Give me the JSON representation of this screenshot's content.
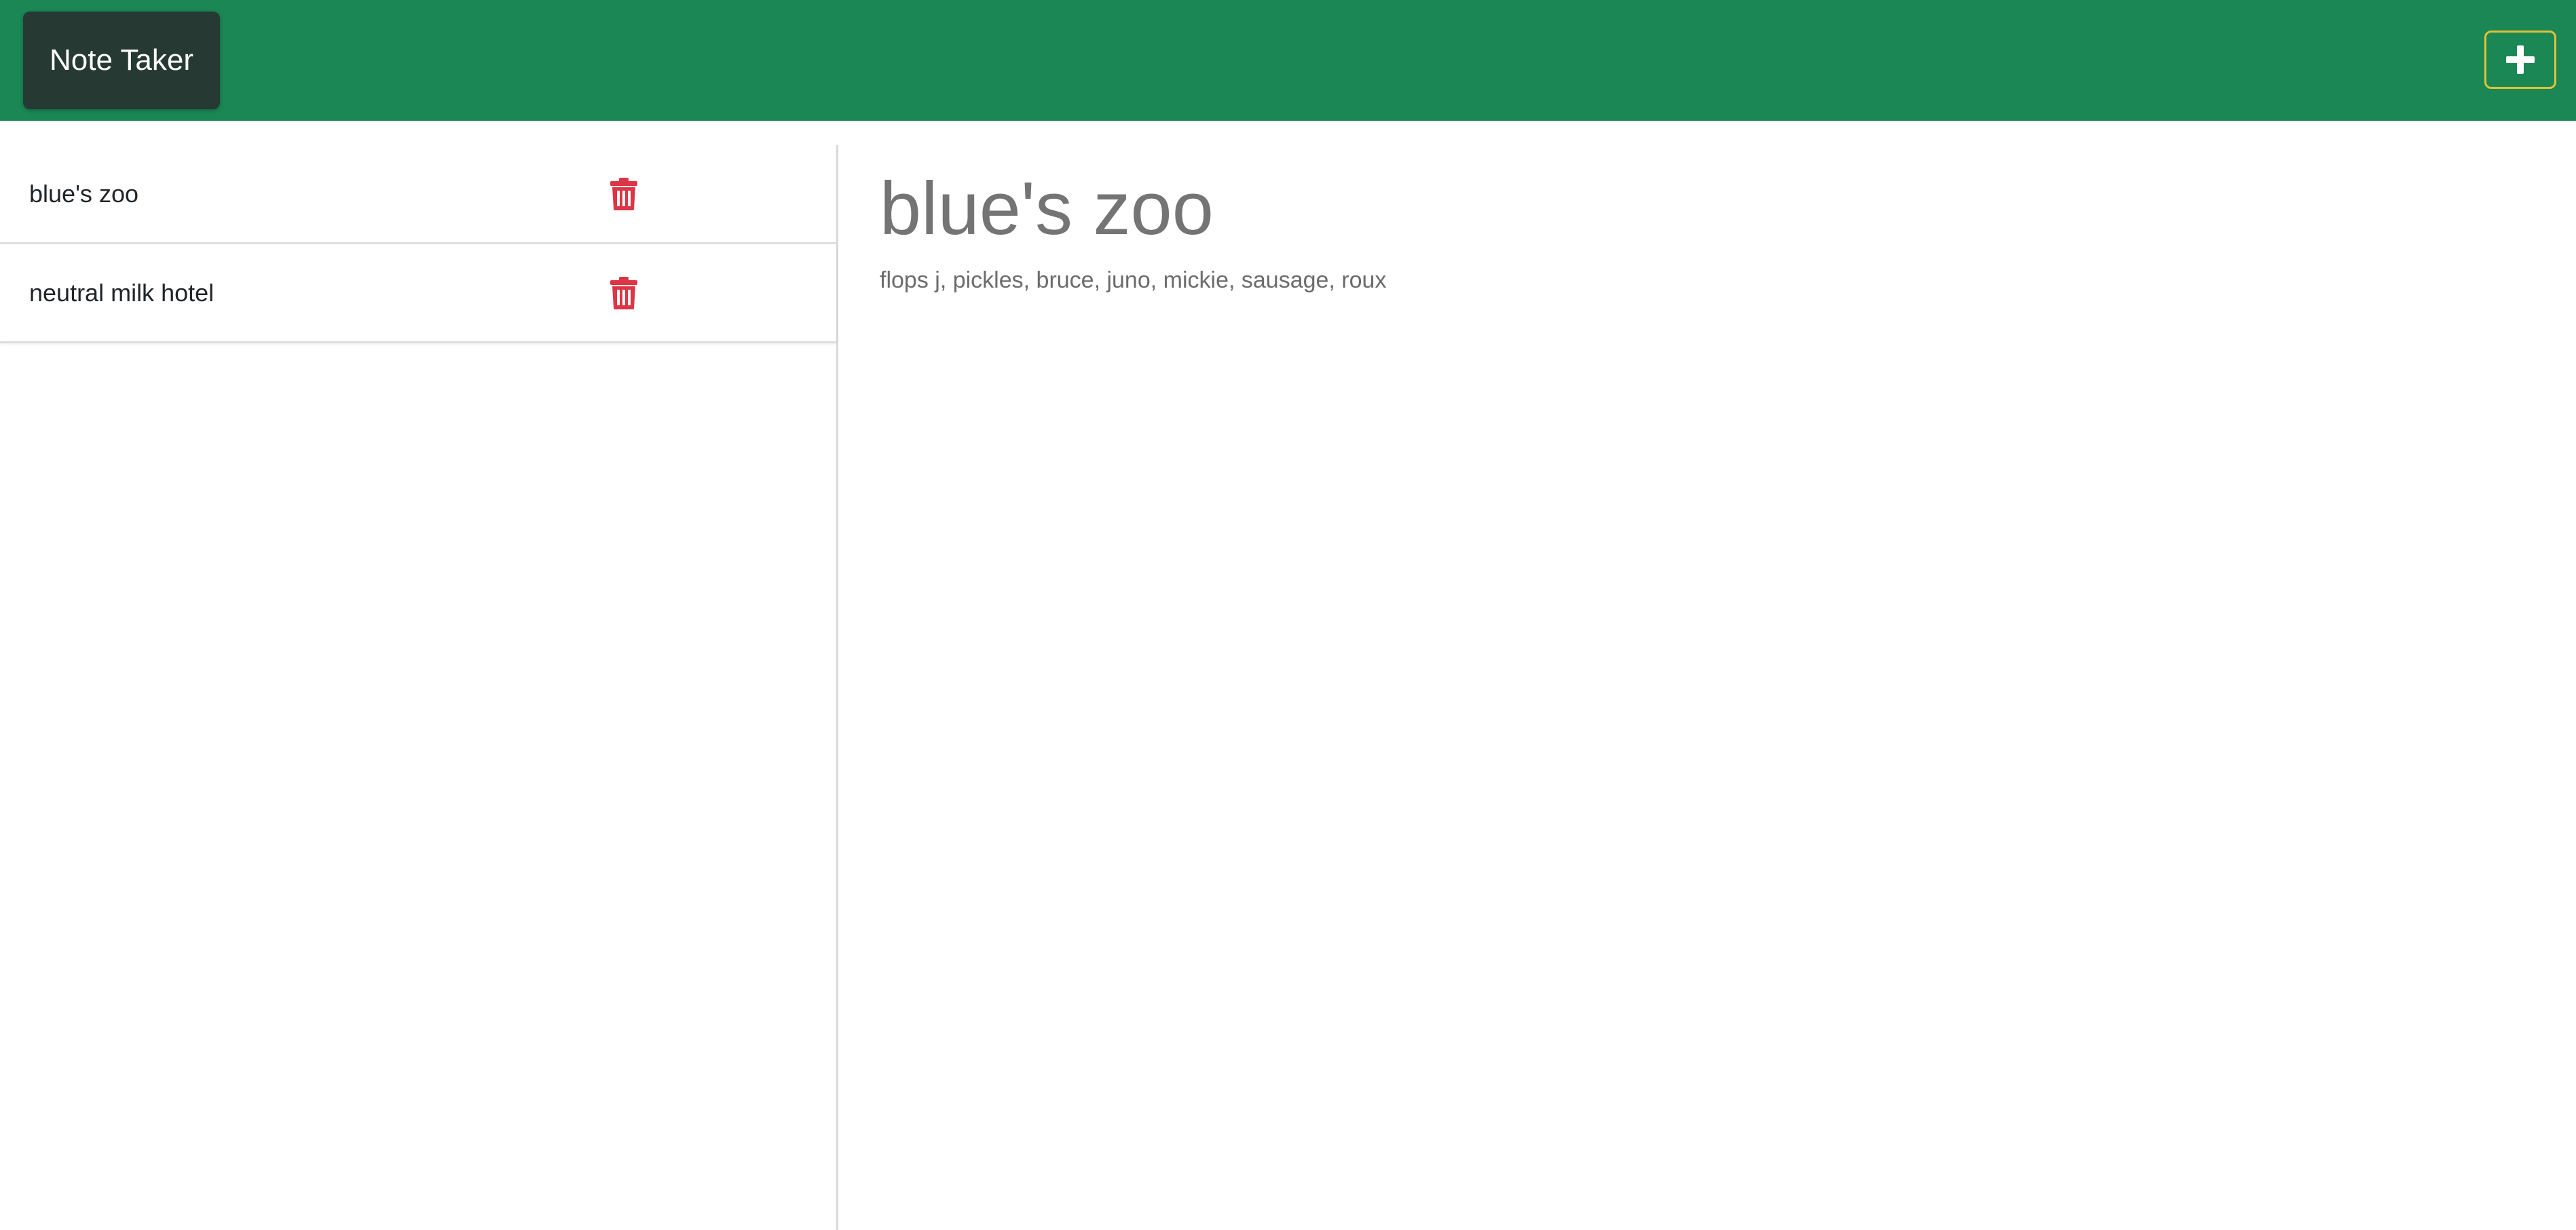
{
  "navbar": {
    "brand": "Note Taker",
    "new_note_icon": "plus-icon",
    "background_color": "#1a8754",
    "new_note_border_color": "#e0c23a"
  },
  "sidebar": {
    "notes": [
      {
        "title": "blue's zoo",
        "delete_icon": "trash-icon"
      },
      {
        "title": "neutral milk hotel",
        "delete_icon": "trash-icon"
      }
    ],
    "delete_color": "#dc3545"
  },
  "editor": {
    "title": "blue's zoo",
    "body": "flops j, pickles, bruce, juno, mickie, sausage, roux"
  }
}
